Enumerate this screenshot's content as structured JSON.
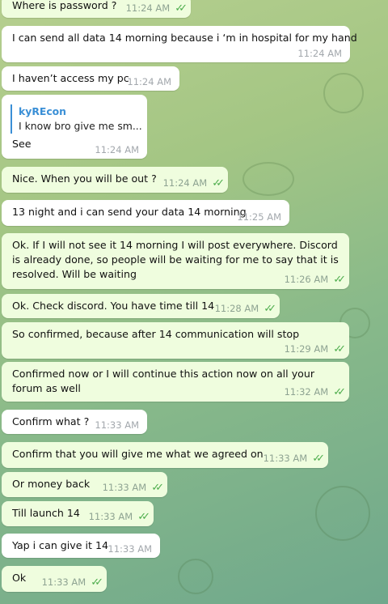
{
  "messages": [
    {
      "dir": "out",
      "text": "Where is password ?",
      "time": "11:24 AM",
      "read": true
    },
    {
      "dir": "in",
      "text": "I can send all data 14 morning because i ‘m in hospital for my hand",
      "time": "11:24 AM"
    },
    {
      "dir": "in",
      "text": "I haven’t access my pc",
      "time": "11:24 AM"
    },
    {
      "dir": "in",
      "reply_name": "kyREcon",
      "reply_text": "I know bro give me sm...",
      "text": "See",
      "time": "11:24 AM"
    },
    {
      "dir": "out",
      "text": "Nice. When you will be out ?",
      "time": "11:24 AM",
      "read": true
    },
    {
      "dir": "in",
      "text": "13 night and i can send your data 14 morning",
      "time": "11:25 AM"
    },
    {
      "dir": "out",
      "text": "Ok. If I will not see it 14 morning I will post everywhere. Discord is already done, so people will be waiting for me to say that it is resolved. Will be waiting",
      "time": "11:26 AM",
      "read": true
    },
    {
      "dir": "out",
      "text": "Ok. Check discord. You have time till 14",
      "time": "11:28 AM",
      "read": true
    },
    {
      "dir": "out",
      "text": "So confirmed, because after 14 communication will stop",
      "time": "11:29 AM",
      "read": true
    },
    {
      "dir": "out",
      "text": "Confirmed now or I will continue this action now on all your forum as well",
      "time": "11:32 AM",
      "read": true
    },
    {
      "dir": "in",
      "text": "Confirm what ?",
      "time": "11:33 AM"
    },
    {
      "dir": "out",
      "text": "Confirm that you will give me what we agreed on",
      "time": "11:33 AM",
      "read": true
    },
    {
      "dir": "out",
      "text": "Or money back",
      "time": "11:33 AM",
      "read": true
    },
    {
      "dir": "out",
      "text": "Till launch 14",
      "time": "11:33 AM",
      "read": true
    },
    {
      "dir": "in",
      "text": "Yap i can give it 14",
      "time": "11:33 AM"
    },
    {
      "dir": "out",
      "text": "Ok",
      "time": "11:33 AM",
      "read": true
    }
  ],
  "read_ticks": "✓✓"
}
